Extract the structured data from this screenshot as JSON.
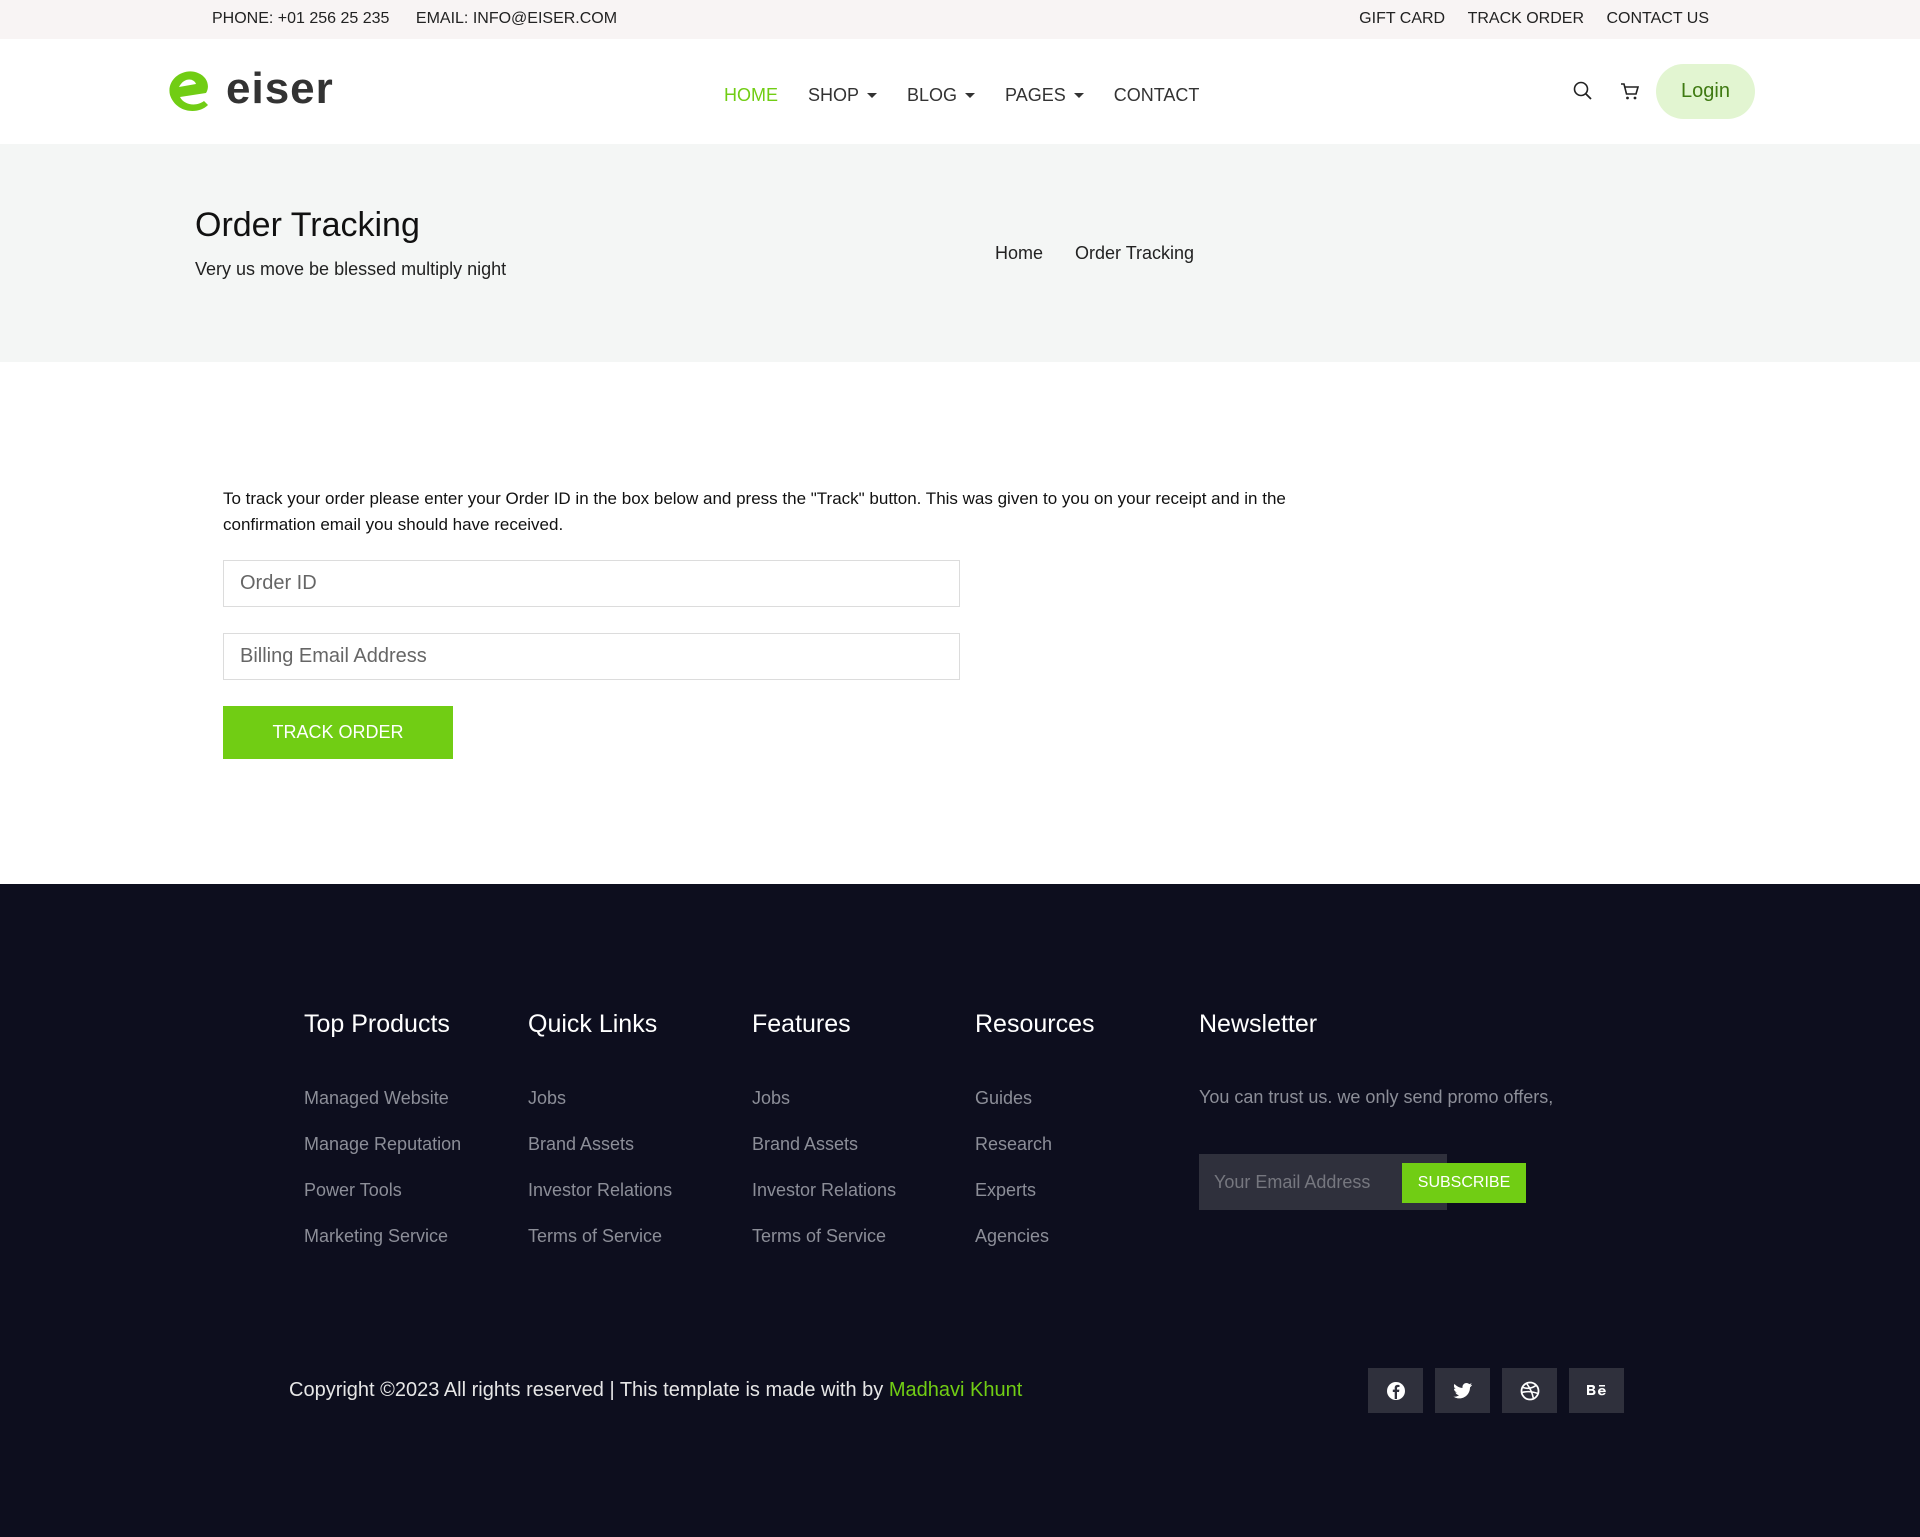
{
  "topbar": {
    "phone": "PHONE: +01 256 25 235",
    "email": "EMAIL: INFO@EISER.COM",
    "links": [
      "GIFT CARD",
      "TRACK ORDER",
      "CONTACT US"
    ]
  },
  "header": {
    "logo_text": "eiser",
    "nav": [
      {
        "label": "HOME",
        "active": true,
        "dropdown": false
      },
      {
        "label": "SHOP",
        "active": false,
        "dropdown": true
      },
      {
        "label": "BLOG",
        "active": false,
        "dropdown": true
      },
      {
        "label": "PAGES",
        "active": false,
        "dropdown": true
      },
      {
        "label": "CONTACT",
        "active": false,
        "dropdown": false
      }
    ],
    "icons": [
      "search-icon",
      "cart-icon"
    ],
    "login_label": "Login"
  },
  "banner": {
    "title": "Order Tracking",
    "subtitle": "Very us move be blessed multiply night",
    "breadcrumb": [
      "Home",
      "Order Tracking"
    ]
  },
  "main": {
    "intro": "To track your order please enter your Order ID in the box below and press the \"Track\" button. This was given to you on your receipt and in the confirmation email you should have received.",
    "order_id_placeholder": "Order ID",
    "email_placeholder": "Billing Email Address",
    "track_button": "TRACK ORDER"
  },
  "footer": {
    "columns": [
      {
        "title": "Top Products",
        "items": [
          "Managed Website",
          "Manage Reputation",
          "Power Tools",
          "Marketing Service"
        ]
      },
      {
        "title": "Quick Links",
        "items": [
          "Jobs",
          "Brand Assets",
          "Investor Relations",
          "Terms of Service"
        ]
      },
      {
        "title": "Features",
        "items": [
          "Jobs",
          "Brand Assets",
          "Investor Relations",
          "Terms of Service"
        ]
      },
      {
        "title": "Resources",
        "items": [
          "Guides",
          "Research",
          "Experts",
          "Agencies"
        ]
      }
    ],
    "newsletter": {
      "title": "Newsletter",
      "text": "You can trust us. we only send promo offers,",
      "placeholder": "Your Email Address",
      "button": "SUBSCRIBE"
    },
    "copyright": "Copyright ©2023 All rights reserved | This template is made with by ",
    "author": "Madhavi Khunt",
    "social": [
      "facebook-icon",
      "twitter-icon",
      "dribbble-icon",
      "behance-icon"
    ]
  },
  "colors": {
    "accent": "#71cd14",
    "footer_bg": "#0d0e1e",
    "banner_bg": "#f4f6f5"
  }
}
